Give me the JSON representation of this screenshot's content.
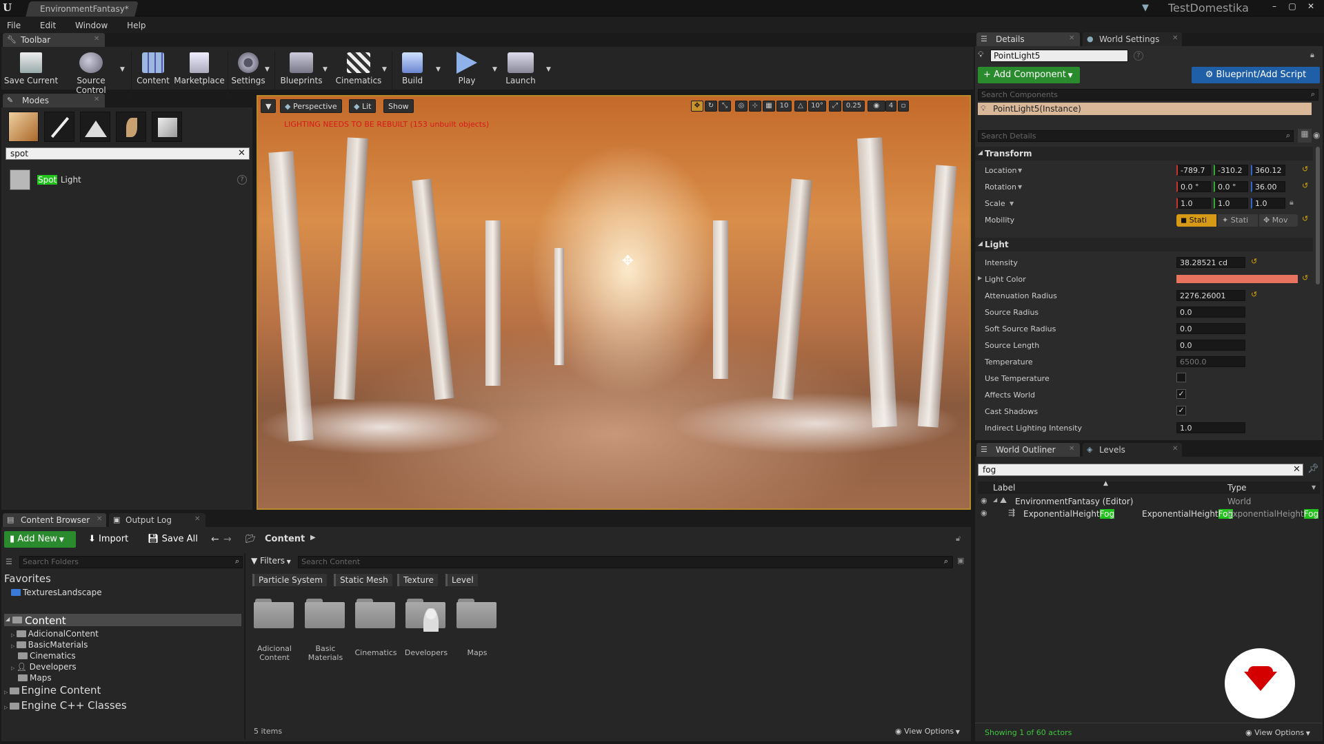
{
  "window": {
    "tab_title": "EnvironmentFantasy*",
    "project": "TestDomestika"
  },
  "menu": [
    "File",
    "Edit",
    "Window",
    "Help"
  ],
  "toolbar": {
    "tab": "Toolbar",
    "buttons": [
      "Save Current",
      "Source Control",
      "Content",
      "Marketplace",
      "Settings",
      "Blueprints",
      "Cinematics",
      "Build",
      "Play",
      "Launch"
    ]
  },
  "modes": {
    "tab": "Modes",
    "search_value": "spot",
    "result_highlight": "Spot",
    "result_rest": " Light"
  },
  "viewport": {
    "perspective": "Perspective",
    "lit": "Lit",
    "show": "Show",
    "warning": "LIGHTING NEEDS TO BE REBUILT (153 unbuilt objects)",
    "grid_snap": "10",
    "rot_snap": "10°",
    "scale_snap": "0.25",
    "camera_speed": "4"
  },
  "details": {
    "tab": "Details",
    "tab2": "World Settings",
    "actor_name": "PointLight5",
    "add_component": "+ Add Component",
    "blueprint": "Blueprint/Add Script",
    "search_components_placeholder": "Search Components",
    "instance": "PointLight5(Instance)",
    "search_details_placeholder": "Search Details",
    "transform_header": "Transform",
    "location_label": "Location",
    "rotation_label": "Rotation",
    "scale_label": "Scale",
    "mobility_label": "Mobility",
    "location": [
      "-789.7",
      "-310.2",
      "360.12"
    ],
    "rotation": [
      "0.0 °",
      "0.0 °",
      "36.00"
    ],
    "scale": [
      "1.0",
      "1.0",
      "1.0"
    ],
    "mobility": [
      "Stati",
      "Stati",
      "Mov"
    ],
    "light_header": "Light",
    "props": {
      "intensity_label": "Intensity",
      "intensity": "38.28521 cd",
      "light_color_label": "Light Color",
      "attenuation_label": "Attenuation Radius",
      "attenuation": "2276.26001",
      "source_radius_label": "Source Radius",
      "source_radius": "0.0",
      "soft_source_label": "Soft Source Radius",
      "soft_source": "0.0",
      "source_length_label": "Source Length",
      "source_length": "0.0",
      "temperature_label": "Temperature",
      "temperature": "6500.0",
      "use_temp_label": "Use Temperature",
      "affects_world_label": "Affects World",
      "cast_shadows_label": "Cast Shadows",
      "indirect_label": "Indirect Lighting Intensity",
      "indirect": "1.0"
    },
    "light_color": "#e8735e"
  },
  "outliner": {
    "tab": "World Outliner",
    "tab2": "Levels",
    "search_value": "fog",
    "col_label": "Label",
    "col_type": "Type",
    "row1_name": "EnvironmentFantasy (Editor)",
    "row1_type": "World",
    "row2_name_pre": "ExponentialHeight",
    "row2_name_hl": "Fog",
    "row2_type_pre": "ExponentialHeight",
    "row2_type_hl": "Fog",
    "row2_extra_pre": "ExponentialHeight",
    "row2_extra_hl": "Fog",
    "status": "Showing 1 of 60 actors",
    "view_options": "View Options"
  },
  "content_browser": {
    "tab": "Content Browser",
    "tab2": "Output Log",
    "add_new": "Add New",
    "import": "Import",
    "save_all": "Save All",
    "path": "Content",
    "search_folders_placeholder": "Search Folders",
    "filters": "Filters",
    "search_content_placeholder": "Search Content",
    "filter_chips": [
      "Particle System",
      "Static Mesh",
      "Texture",
      "Level"
    ],
    "favorites": "Favorites",
    "favorite_item": "TexturesLandscape",
    "tree_root": "Content",
    "tree_children": [
      "AdicionalContent",
      "BasicMaterials",
      "Cinematics",
      "Developers",
      "Maps"
    ],
    "engine_content": "Engine Content",
    "engine_cpp": "Engine C++ Classes",
    "folders": [
      "Adicional\nContent",
      "Basic\nMaterials",
      "Cinematics",
      "Developers",
      "Maps"
    ],
    "item_count": "5 items",
    "view_options": "View Options"
  },
  "watermark_color": "#d40000"
}
